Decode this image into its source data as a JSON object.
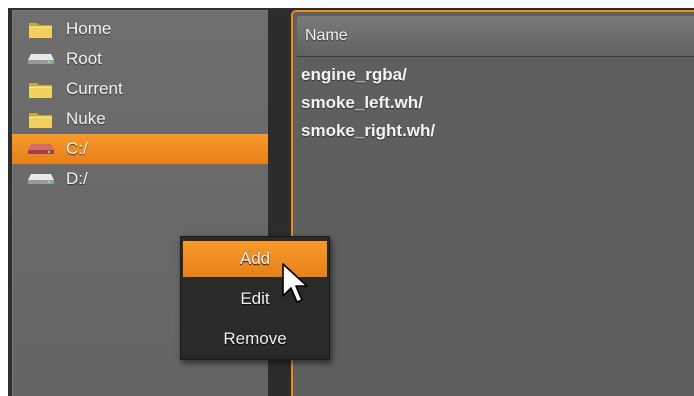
{
  "sidebar": {
    "items": [
      {
        "label": "Home",
        "icon": "folder-icon"
      },
      {
        "label": "Root",
        "icon": "drive-icon"
      },
      {
        "label": "Current",
        "icon": "folder-icon"
      },
      {
        "label": "Nuke",
        "icon": "folder-icon"
      },
      {
        "label": "C:/",
        "icon": "drive-icon",
        "selected": true
      },
      {
        "label": "D:/",
        "icon": "drive-icon"
      }
    ]
  },
  "file_list": {
    "column_header": "Name",
    "rows": [
      {
        "name": "engine_rgba/"
      },
      {
        "name": "smoke_left.wh/"
      },
      {
        "name": "smoke_right.wh/"
      }
    ]
  },
  "context_menu": {
    "items": [
      {
        "label": "Add",
        "highlighted": true
      },
      {
        "label": "Edit"
      },
      {
        "label": "Remove"
      }
    ]
  },
  "colors": {
    "accent": "#ee8c22",
    "panel": "#666666",
    "background": "#2e2e2e"
  }
}
